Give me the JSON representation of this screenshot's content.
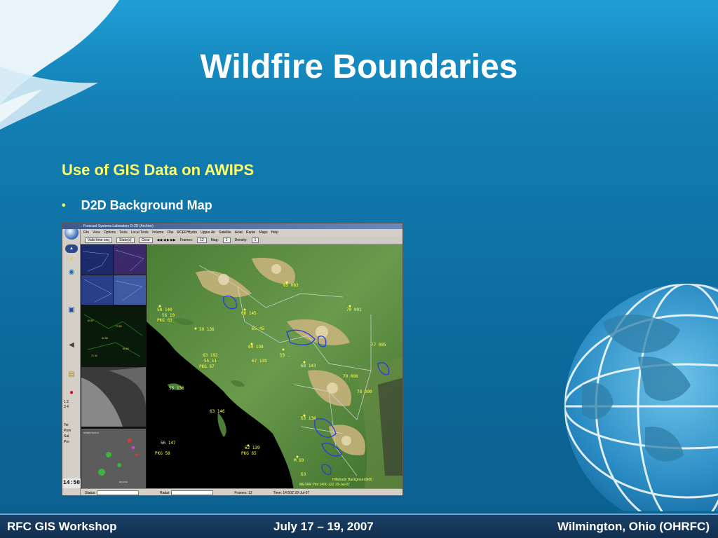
{
  "slide": {
    "title": "Wildfire Boundaries",
    "subtitle": "Use of GIS Data on AWIPS",
    "bullet": "D2D Background Map"
  },
  "awips_window": {
    "title_bar": "Forecast Systems Laboratory D-2D (Archive)",
    "menus": [
      "File",
      "View",
      "Options",
      "Tools",
      "Local Tools",
      "Volume",
      "Obs",
      "RCEP/Hydro",
      "Upper Air",
      "Satellite",
      "Aviat",
      "Radar",
      "Maps",
      "Help"
    ],
    "toolbar": {
      "valid_time": "Valid time seq",
      "state": "State(s)",
      "clear": "Clear",
      "frames_label": "Frames:",
      "frames_value": "12",
      "mag_label": "Mag:",
      "mag_value": "1",
      "density_label": "Density:",
      "density_value": "1"
    },
    "clock": "14:50",
    "status_label": "Status:",
    "radar_label": "Radar:",
    "frames_status": "Frames: 12",
    "time_status": "Time: 14:50Z 29-Jul-07",
    "map_legend_1": "Hillshade Background(kft)",
    "map_legend_2": "METAR Plot 1400 12Z 29-Jul-07",
    "side_items": [
      "Ter",
      "Pom",
      "Sat",
      "Pro"
    ],
    "side_numbers": [
      "1",
      "2",
      "3",
      "4"
    ]
  },
  "footer": {
    "left": "RFC GIS Workshop",
    "center": "July 17 – 19, 2007",
    "right": "Wilmington, Ohio (OHRFC)"
  },
  "colors": {
    "title_text": "#ffffff",
    "subtitle_text": "#ffff66",
    "footer_bg": "#12304f",
    "map_terrain_low": "#3c6e2c",
    "map_terrain_high": "#d9c08a",
    "fire_boundary": "#2a3fd8",
    "metar_plot": "#ffff55"
  }
}
